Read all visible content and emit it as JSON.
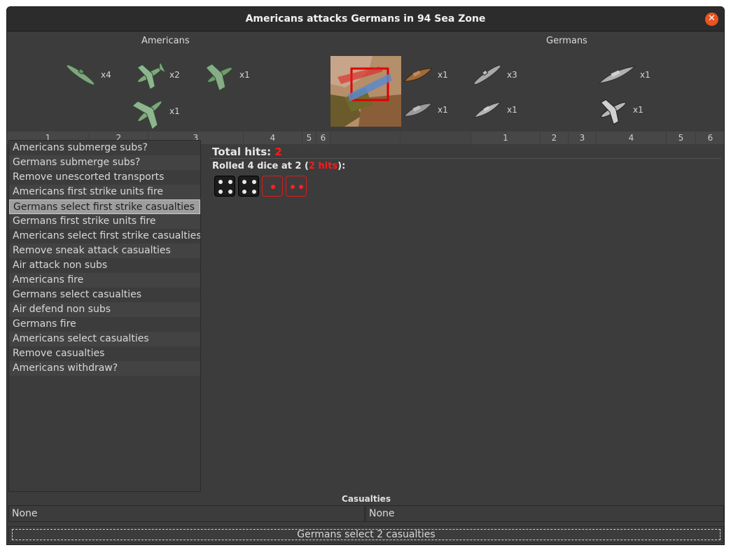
{
  "window": {
    "title": "Americans attacks Germans in 94 Sea Zone"
  },
  "attacker": {
    "name": "Americans",
    "units": [
      {
        "icon": "submarine-icon",
        "count": "x4",
        "color": "#7fa67f"
      },
      {
        "icon": "fighter-icon",
        "count": "x2",
        "color": "#7fa67f"
      },
      {
        "icon": "tactical-bomber-icon",
        "count": "x1",
        "color": "#7fa67f"
      },
      {
        "icon": "bomber-icon",
        "count": "x1",
        "color": "#7fa67f"
      }
    ],
    "columns": [
      "1",
      "2",
      "3",
      "4",
      "5",
      "6"
    ]
  },
  "defender": {
    "name": "Germans",
    "units": [
      {
        "icon": "transport-icon",
        "count": "x1",
        "color": "#a06a3a"
      },
      {
        "icon": "submarine-icon",
        "count": "x3",
        "color": "#a9a9a9"
      },
      {
        "icon": "battleship-icon",
        "count": "x1",
        "color": "#a9a9a9"
      },
      {
        "icon": "transport-icon",
        "count": "x1",
        "color": "#a9a9a9"
      },
      {
        "icon": "destroyer-icon",
        "count": "x1",
        "color": "#a9a9a9"
      },
      {
        "icon": "fighter-icon",
        "count": "x1",
        "color": "#a9a9a9"
      }
    ],
    "columns": [
      "1",
      "2",
      "3",
      "4",
      "5",
      "6"
    ]
  },
  "steps": [
    "Americans submerge subs?",
    "Germans submerge subs?",
    "Remove unescorted transports",
    "Americans first strike units fire",
    "Germans select first strike casualties",
    "Germans first strike units fire",
    "Americans select first strike casualties",
    "Remove sneak attack casualties",
    "Air attack non subs",
    "Americans fire",
    "Germans select casualties",
    "Air defend non subs",
    "Germans fire",
    "Americans select casualties",
    "Remove casualties",
    "Americans withdraw?"
  ],
  "selected_step": 4,
  "results": {
    "total_hits_label": "Total hits:",
    "total_hits_value": "2",
    "roll_prefix": "Rolled 4 dice at 2 (",
    "roll_hits": "2 hits",
    "roll_suffix": "):",
    "dice": [
      {
        "value": 4,
        "hit": false
      },
      {
        "value": 4,
        "hit": false
      },
      {
        "value": 1,
        "hit": true
      },
      {
        "value": 2,
        "hit": true
      }
    ]
  },
  "casualties": {
    "title": "Casualties",
    "left": "None",
    "right": "None"
  },
  "action_button": "Germans select 2 casualties"
}
